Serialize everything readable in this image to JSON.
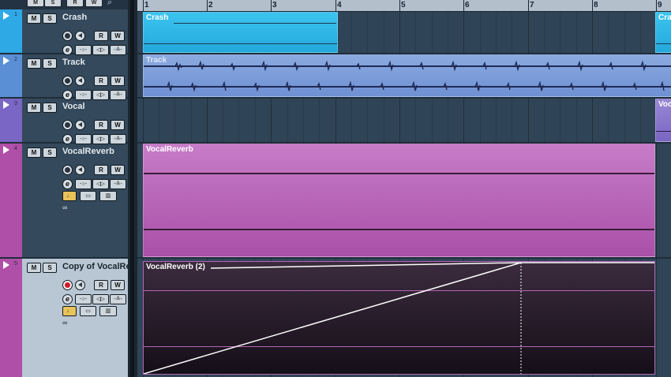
{
  "toolbar": {
    "buttons": [
      "M",
      "S",
      "R",
      "W"
    ],
    "search_icon": "⌕"
  },
  "ruler": {
    "bars": [
      "1",
      "2",
      "3",
      "4",
      "5",
      "6",
      "7",
      "8",
      "9"
    ]
  },
  "buttons": {
    "mute": "M",
    "solo": "S",
    "read": "R",
    "write": "W",
    "edit": "e",
    "io1": "-○-",
    "io2": "◁▷",
    "io3": "-≙-",
    "chain": "∞"
  },
  "tracks": [
    {
      "num": "1",
      "name": "Crash",
      "color": "#2fa8e6"
    },
    {
      "num": "2",
      "name": "Track",
      "color": "#5a8fd6"
    },
    {
      "num": "3",
      "name": "Vocal",
      "color": "#7a66c4"
    },
    {
      "num": "4",
      "name": "VocalReverb",
      "color": "#b04fa8"
    },
    {
      "num": "5",
      "name": "Copy of VocalReverb",
      "color": "#b04fa8",
      "selected": true,
      "record_armed": true
    }
  ],
  "parts": {
    "crash_1": "Crash",
    "crash_2": "Cra",
    "track": "Track",
    "vocal": "Voc",
    "vocalreverb": "VocalReverb",
    "vocalreverb2": "VocalReverb (2)"
  },
  "colors": {
    "crash": "#30b8ea",
    "track": "#7f9fd8",
    "vocal": "#8a78c8",
    "vocalreverb": "#b565b6",
    "copy_bg": "#1c1620",
    "envelope": "#ffffff"
  }
}
